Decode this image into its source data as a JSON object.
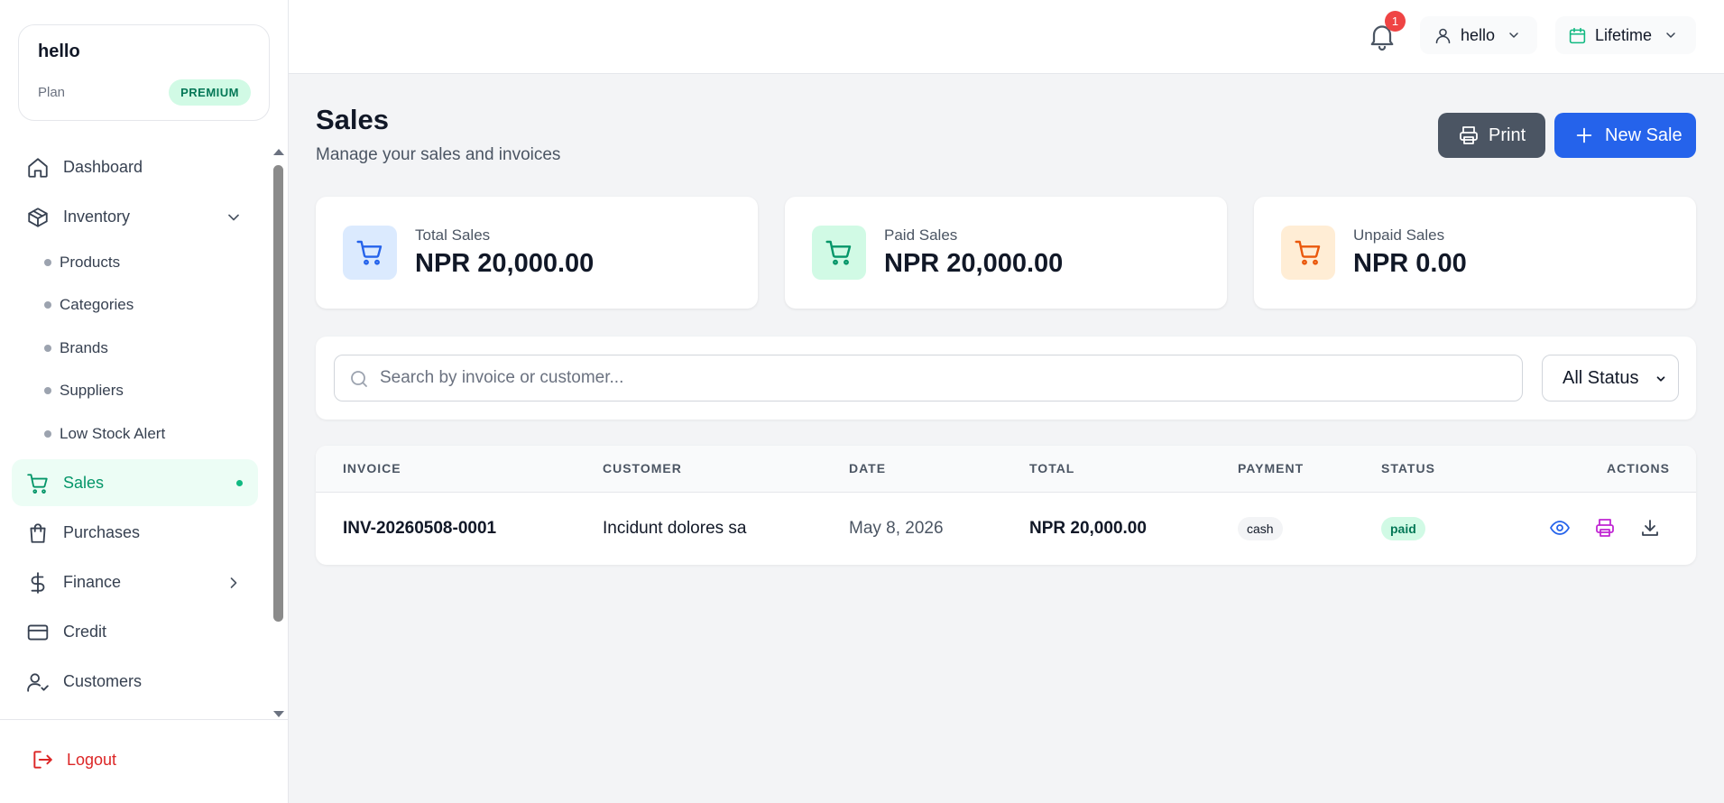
{
  "sidebar": {
    "account": {
      "name": "hello",
      "plan_label": "Plan",
      "plan_badge": "PREMIUM"
    },
    "nav": {
      "dashboard": "Dashboard",
      "inventory": "Inventory",
      "products": "Products",
      "categories": "Categories",
      "brands": "Brands",
      "suppliers": "Suppliers",
      "low_stock": "Low Stock Alert",
      "sales": "Sales",
      "purchases": "Purchases",
      "finance": "Finance",
      "credit": "Credit",
      "customers": "Customers"
    },
    "logout": "Logout"
  },
  "header": {
    "notifications_count": "1",
    "user": "hello",
    "period": "Lifetime"
  },
  "page": {
    "title": "Sales",
    "subtitle": "Manage your sales and invoices",
    "print_label": "Print",
    "new_sale_label": "New Sale"
  },
  "stats": [
    {
      "label": "Total Sales",
      "value": "NPR 20,000.00",
      "icon": "cart-icon",
      "color": "#2563eb"
    },
    {
      "label": "Paid Sales",
      "value": "NPR 20,000.00",
      "icon": "cart-icon",
      "color": "#059669"
    },
    {
      "label": "Unpaid Sales",
      "value": "NPR 0.00",
      "icon": "cart-icon",
      "color": "#ea580c"
    }
  ],
  "filters": {
    "search_placeholder": "Search by invoice or customer...",
    "status": "All Status"
  },
  "table": {
    "columns": {
      "invoice": "INVOICE",
      "customer": "CUSTOMER",
      "date": "DATE",
      "total": "TOTAL",
      "payment": "PAYMENT",
      "status": "STATUS",
      "actions": "ACTIONS"
    },
    "rows": [
      {
        "invoice": "INV-20260508-0001",
        "customer": "Incidunt dolores sa",
        "date": "May 8, 2026",
        "total": "NPR 20,000.00",
        "payment": "cash",
        "status": "paid"
      }
    ]
  },
  "colors": {
    "brand_green": "#059669",
    "primary_blue": "#2563eb",
    "print_gray": "#4b5563",
    "logout_red": "#dc2626",
    "view_icon": "#2563eb",
    "print_icon": "#c026d3",
    "download_icon": "#374151"
  }
}
